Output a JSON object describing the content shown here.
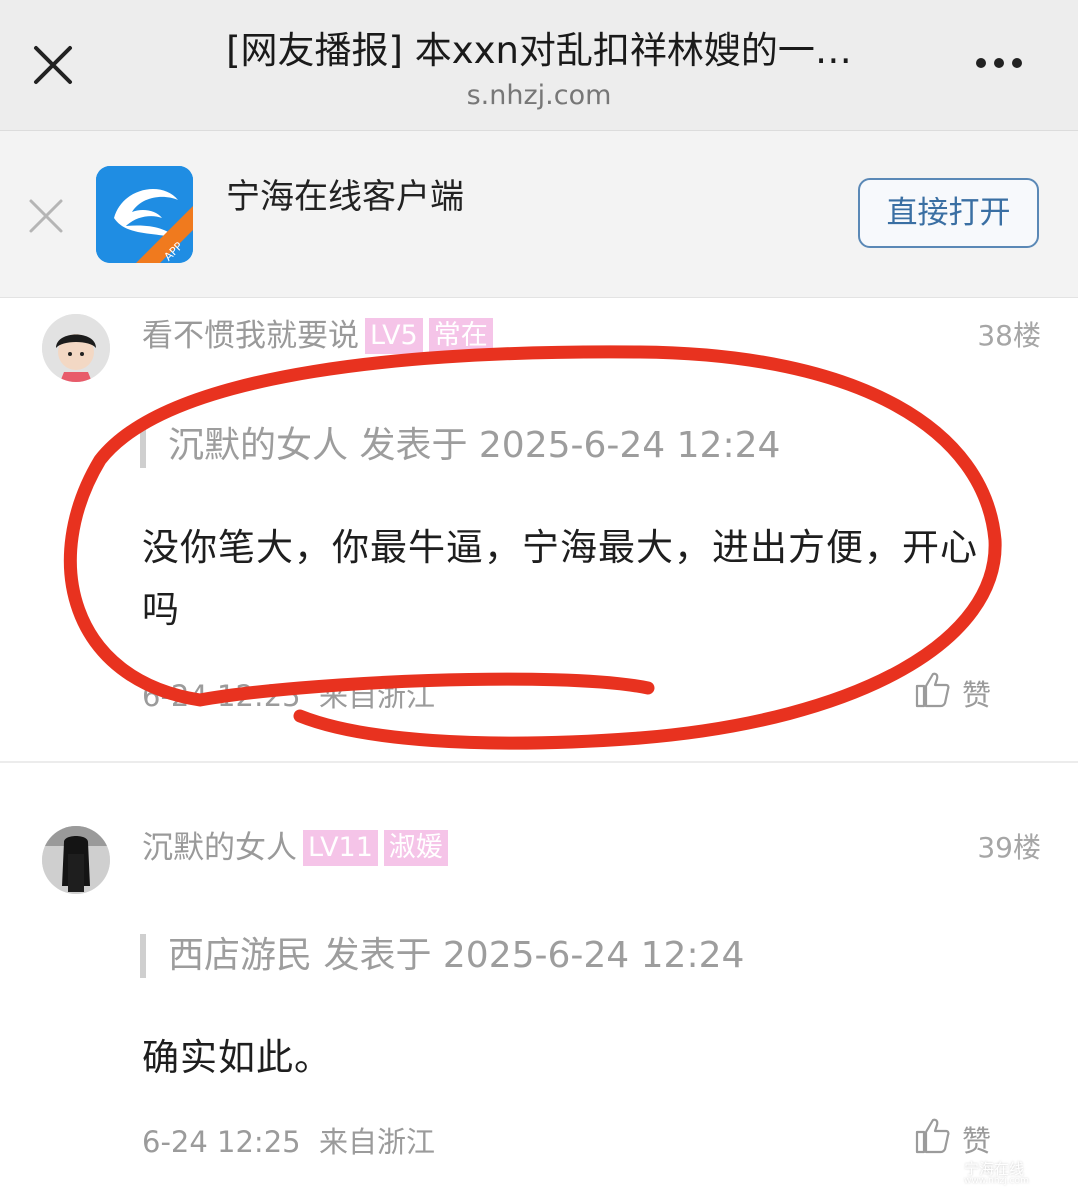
{
  "header": {
    "title": "[网友播报] 本xxn对乱扣祥林嫂的一…",
    "domain": "s.nhzj.com"
  },
  "banner": {
    "app_name": "宁海在线客户端",
    "app_icon_label": "APP",
    "open_label": "直接打开"
  },
  "posts": [
    {
      "username": "看不惯我就要说",
      "level": "LV5",
      "title_badge": "常在",
      "floor": "38楼",
      "quote": "沉默的女人 发表于 2025-6-24 12:24",
      "content": "没你笔大，你最牛逼，宁海最大，进出方便，开心吗",
      "time": "6-24 12:25",
      "location": "来自浙江",
      "like_label": "赞"
    },
    {
      "username": "沉默的女人",
      "level": "LV11",
      "title_badge": "淑媛",
      "floor": "39楼",
      "quote": "西店游民 发表于 2025-6-24 12:24",
      "content": "确实如此。",
      "time": "6-24 12:25",
      "location": "来自浙江",
      "like_label": "赞"
    }
  ],
  "watermark": {
    "text": "宁海在线",
    "url": "www.nhzj.com"
  },
  "colors": {
    "annotation": "#e8321f",
    "badge": "#f5c4e8",
    "button_border": "#5a88b6",
    "app_icon": "#1f8de3",
    "app_ribbon": "#f07a1e"
  }
}
